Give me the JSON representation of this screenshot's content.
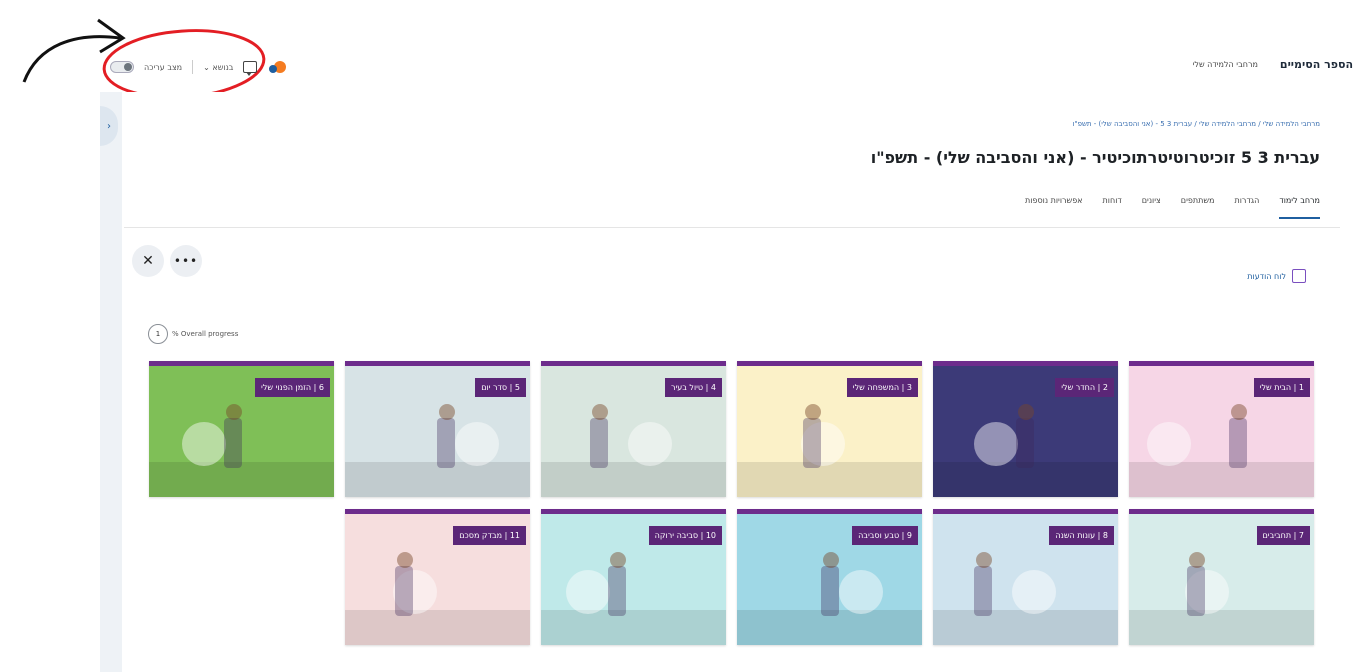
{
  "topbar": {
    "edit_mode_label": "מצב עריכה",
    "language_label": "בנושא",
    "brand": "הספר הסימיים",
    "nav_link": "מרחבי הלמידה שלי"
  },
  "breadcrumb": "מרחבי הלמידה שלי / מרחבי הלמידה שלי / עברית 3 5 - (אני והסביבה שלי) - תשפ\"ו",
  "page": {
    "title": "עברית 3 5 זוכיטרוטיטרתוכיטיר - (אני והסביבה שלי) - תשפ\"ו"
  },
  "tabs": [
    "מרחב לימוד",
    "הגדרות",
    "משתתפים",
    "ציונים",
    "דוחות",
    "אפשרויות נוספות"
  ],
  "announcements": {
    "label": "לוח הודעות"
  },
  "progress": {
    "value": "1",
    "label": "% Overall progress"
  },
  "cards": [
    {
      "label": "1 | הבית שלי",
      "bg": "#f6d6e6"
    },
    {
      "label": "2 | החדר שלי",
      "bg": "#3c3a78"
    },
    {
      "label": "3 | המשפחה שלי",
      "bg": "#fbf1c8"
    },
    {
      "label": "4 | טיול בעיר",
      "bg": "#d9e6df"
    },
    {
      "label": "5 | סדר יום",
      "bg": "#d7e3e6"
    },
    {
      "label": "6 | הזמן הפנוי שלי",
      "bg": "#7fbf57"
    },
    {
      "label": "7 | תחביבים",
      "bg": "#d7ecea"
    },
    {
      "label": "8 | עונות השנה",
      "bg": "#cfe3ee"
    },
    {
      "label": "9 | טבע וסביבה",
      "bg": "#9fd8e6"
    },
    {
      "label": "10 | סביבה ירוקה",
      "bg": "#bfe9e9"
    },
    {
      "label": "11 | מבדק מסכם",
      "bg": "#f6dede"
    }
  ],
  "colors": {
    "accent": "#6d2c8c",
    "label_bg": "#5b2677",
    "link": "#1f5fa0",
    "annotation": "#e31e24"
  },
  "icons": [
    "close-icon",
    "more-icon",
    "announcement-icon",
    "chat-icon",
    "notification-icon",
    "annotation-arrow"
  ]
}
